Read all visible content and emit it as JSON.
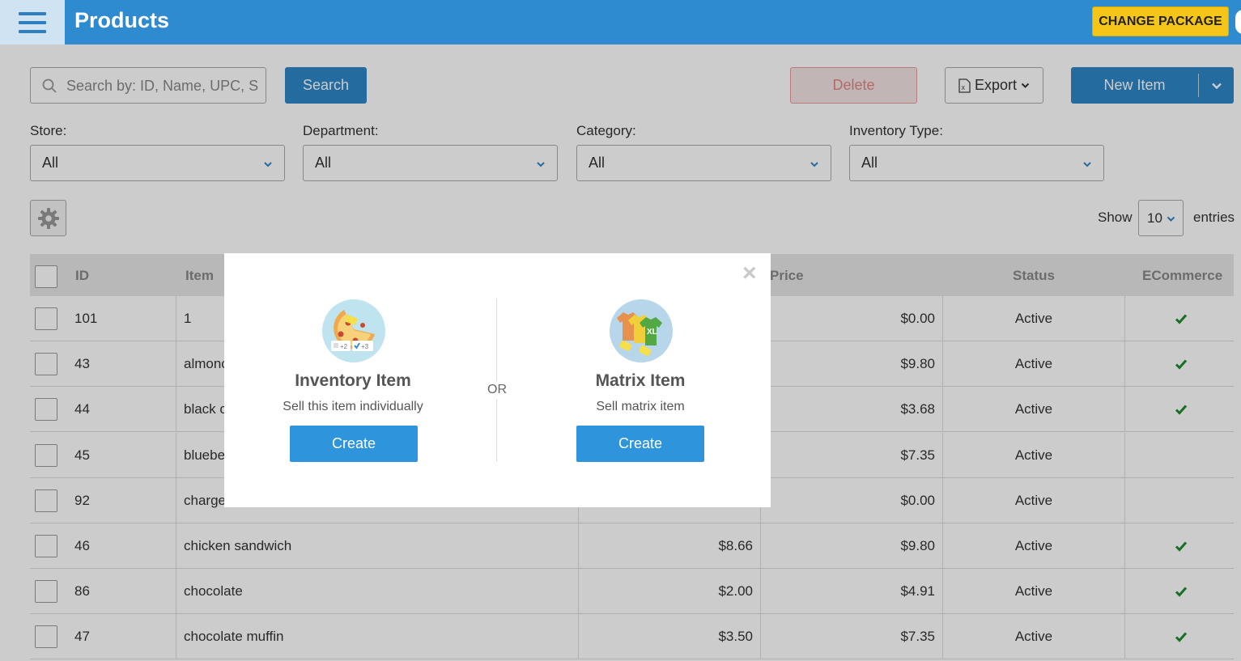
{
  "header": {
    "title": "Products",
    "change_package_label": "CHANGE PACKAGE"
  },
  "toolbar": {
    "search_placeholder": "Search by: ID, Name, UPC, S",
    "search_button": "Search",
    "delete_button": "Delete",
    "export_button": "Export",
    "new_item_button": "New Item"
  },
  "filters": [
    {
      "label": "Store:",
      "value": "All"
    },
    {
      "label": "Department:",
      "value": "All"
    },
    {
      "label": "Category:",
      "value": "All"
    },
    {
      "label": "Inventory Type:",
      "value": "All"
    }
  ],
  "pagination": {
    "show_label": "Show",
    "entries_value": "10",
    "entries_label": "entries"
  },
  "table": {
    "columns": [
      "ID",
      "Item",
      "Price",
      "Status",
      "ECommerce"
    ],
    "rows": [
      {
        "id": "101",
        "item": "1",
        "cost": "",
        "price": "$0.00",
        "status": "Active",
        "ecommerce": true
      },
      {
        "id": "43",
        "item": "almonc",
        "cost": "",
        "price": "$9.80",
        "status": "Active",
        "ecommerce": true
      },
      {
        "id": "44",
        "item": "black c",
        "cost": "",
        "price": "$3.68",
        "status": "Active",
        "ecommerce": true
      },
      {
        "id": "45",
        "item": "bluebe",
        "cost": "",
        "price": "$7.35",
        "status": "Active",
        "ecommerce": false
      },
      {
        "id": "92",
        "item": "charge",
        "cost": "",
        "price": "$0.00",
        "status": "Active",
        "ecommerce": false
      },
      {
        "id": "46",
        "item": "chicken sandwich",
        "cost": "$8.66",
        "price": "$9.80",
        "status": "Active",
        "ecommerce": true
      },
      {
        "id": "86",
        "item": "chocolate",
        "cost": "$2.00",
        "price": "$4.91",
        "status": "Active",
        "ecommerce": true
      },
      {
        "id": "47",
        "item": "chocolate muffin",
        "cost": "$3.50",
        "price": "$7.35",
        "status": "Active",
        "ecommerce": true
      }
    ]
  },
  "modal": {
    "close_label": "×",
    "or_label": "OR",
    "inventory": {
      "title": "Inventory Item",
      "description": "Sell this item individually",
      "button": "Create",
      "icon_badges": [
        "+2",
        "+3"
      ]
    },
    "matrix": {
      "title": "Matrix Item",
      "description": "Sell matrix item",
      "button": "Create",
      "icon_badge": "XL"
    }
  },
  "colors": {
    "header_bg": "#2f8bcf",
    "primary": "#2e86c8",
    "modal_button": "#2e95dc",
    "change_package": "#f5c518",
    "delete_text": "#e08585",
    "check": "#1e8a2e"
  }
}
